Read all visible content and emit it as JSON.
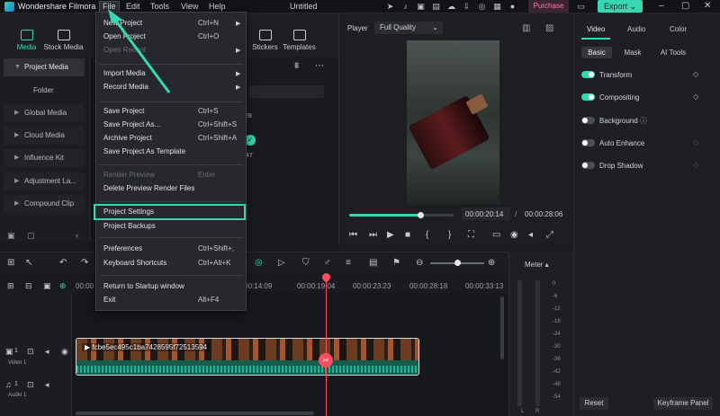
{
  "app": {
    "name": "Wondershare Filmora",
    "project_title": "Untitled"
  },
  "menubar": {
    "file": "File",
    "edit": "Edit",
    "tools": "Tools",
    "view": "View",
    "help": "Help"
  },
  "titlebar": {
    "purchase": "Purchase",
    "export": "Export"
  },
  "toolbar": {
    "items": [
      "Media",
      "Stock Media",
      "Stickers",
      "Templates"
    ]
  },
  "sidebar": {
    "items": [
      "Project Media",
      "Global Media",
      "Cloud Media",
      "Influence Kit",
      "Adjustment La...",
      "Compound Clip"
    ],
    "folder": "Folder"
  },
  "media": {
    "thumb_label": "28",
    "thumb_duration": "47"
  },
  "player": {
    "label": "Player",
    "quality": "Full Quality",
    "current_time": "00:00:20:14",
    "total_time": "00:00:28:06",
    "progress": 0.68
  },
  "right_panel": {
    "tabs": [
      "Video",
      "Audio",
      "Color"
    ],
    "subtabs": [
      "Basic",
      "Mask",
      "AI Tools"
    ],
    "properties": [
      {
        "label": "Transform",
        "on": true
      },
      {
        "label": "Compositing",
        "on": true
      },
      {
        "label": "Background",
        "on": false
      },
      {
        "label": "Auto Enhance",
        "on": false
      },
      {
        "label": "Drop Shadow",
        "on": false
      }
    ],
    "reset": "Reset",
    "keyframe": "Keyframe Panel"
  },
  "timeline": {
    "ruler": [
      "00:00",
      "00:00:14:09",
      "00:00:19:04",
      "00:00:23:23",
      "00:00:28:18",
      "00:00:33:13"
    ],
    "tracks": [
      {
        "name": "Video 1",
        "num": "1"
      },
      {
        "name": "Audio 1",
        "num": "1"
      }
    ],
    "clip_name": "fcbe5ec495c1ba7428595f72513594",
    "zoom": 0.45
  },
  "meter": {
    "label": "Meter",
    "scale": [
      "0",
      "-6",
      "-12",
      "-18",
      "-24",
      "-30",
      "-36",
      "-42",
      "-48",
      "-54"
    ],
    "channels": [
      "L",
      "R"
    ]
  },
  "file_menu": {
    "items": [
      {
        "label": "New Project",
        "shortcut": "Ctrl+N",
        "submenu": true
      },
      {
        "label": "Open Project",
        "shortcut": "Ctrl+O"
      },
      {
        "label": "Open Recent",
        "shortcut": "",
        "submenu": true,
        "disabled": true
      },
      {
        "label": "Import Media",
        "shortcut": "",
        "submenu": true
      },
      {
        "label": "Record Media",
        "shortcut": "",
        "submenu": true
      },
      {
        "label": "Save Project",
        "shortcut": "Ctrl+S"
      },
      {
        "label": "Save Project As...",
        "shortcut": "Ctrl+Shift+S"
      },
      {
        "label": "Archive Project",
        "shortcut": "Ctrl+Shift+A"
      },
      {
        "label": "Save Project As Template",
        "shortcut": ""
      },
      {
        "label": "Render Preview",
        "shortcut": "Enter",
        "disabled": true
      },
      {
        "label": "Delete Preview Render Files",
        "shortcut": ""
      },
      {
        "label": "Project Settings",
        "shortcut": "",
        "highlighted": true
      },
      {
        "label": "Project Backups",
        "shortcut": ""
      },
      {
        "label": "Preferences",
        "shortcut": "Ctrl+Shift+,"
      },
      {
        "label": "Keyboard Shortcuts",
        "shortcut": "Ctrl+Alt+K"
      },
      {
        "label": "Return to Startup window",
        "shortcut": ""
      },
      {
        "label": "Exit",
        "shortcut": "Alt+F4"
      }
    ]
  },
  "colors": {
    "accent": "#37d7b0",
    "playhead": "#ff4d5e",
    "purchase": "#ff7ea8"
  }
}
